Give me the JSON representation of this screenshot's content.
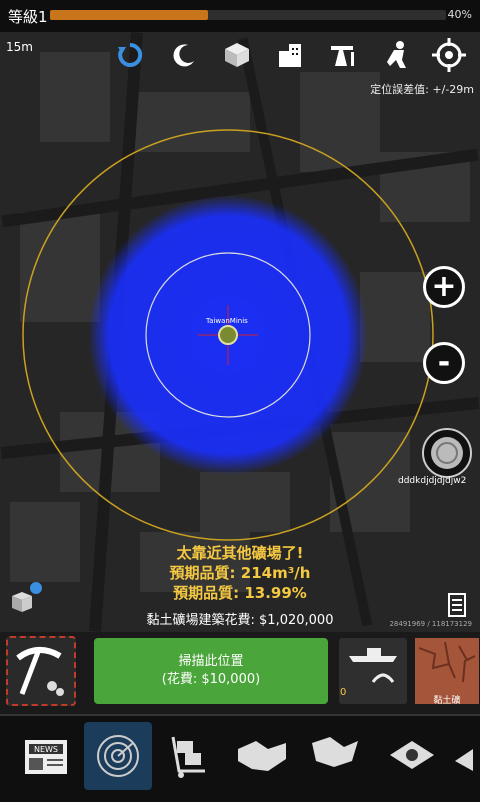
{
  "status": {
    "level": "等級1",
    "progress_percent_text": "40%",
    "progress_fraction": 0.4
  },
  "map": {
    "distance": "15m",
    "accuracy": "定位誤差值: +/-29m",
    "username": "dddkdjdjdjdjw2",
    "coords": "28491969 / 118173129",
    "marker_label": "TaiwanMinis"
  },
  "messages": {
    "warning": "太靠近其他礦場了!",
    "expected_quality1": "預期品質: 214m³/h",
    "expected_quality2": "預期品質: 13.99%",
    "build_cost": "黏土礦場建築花費: $1,020,000"
  },
  "actions": {
    "scan_title": "掃描此位置",
    "scan_cost": "(花費: $10,000)",
    "plane_count": "0",
    "clay_label": "黏土礦"
  },
  "toolbar": [
    "refresh-icon",
    "moon-icon",
    "cube-icon",
    "building-icon",
    "oil-pump-icon",
    "person-icon",
    "crosshair-icon"
  ],
  "nav": {
    "news_label": "NEWS"
  },
  "colors": {
    "accent": "#c8751b",
    "scan_button": "#4aa63a",
    "warning": "#f5c842",
    "blue_area": "#1a2fff",
    "circle": "#c9a020"
  }
}
